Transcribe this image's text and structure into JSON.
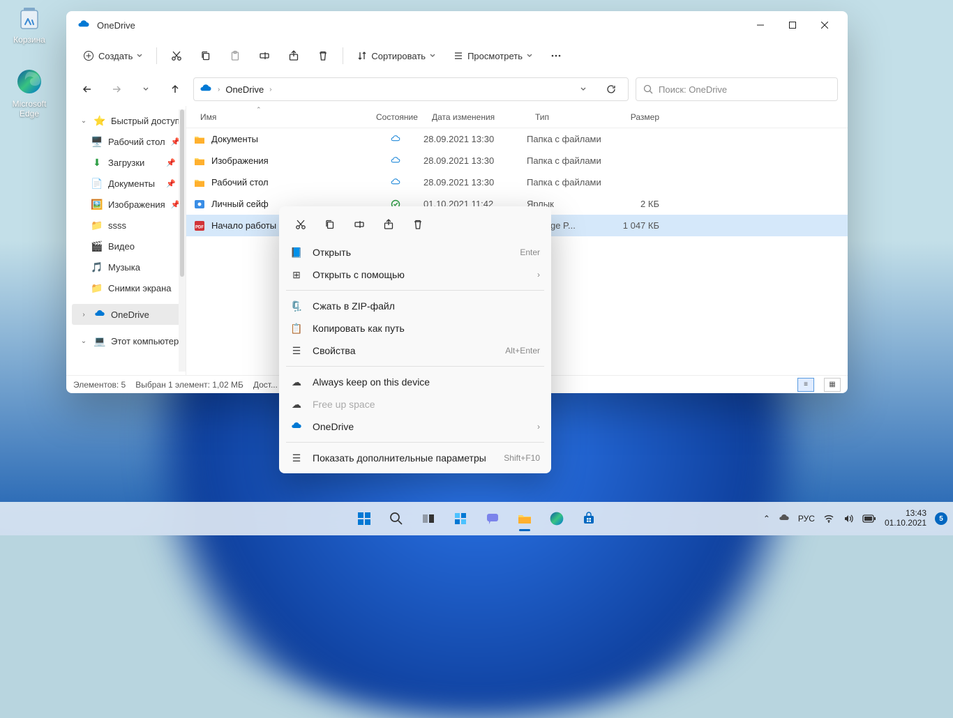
{
  "desktop": {
    "recycle_bin": "Корзина",
    "edge": "Microsoft Edge"
  },
  "window": {
    "title": "OneDrive",
    "toolbar": {
      "create": "Создать",
      "sort": "Сортировать",
      "view": "Просмотреть"
    },
    "nav": {
      "breadcrumb_root": "OneDrive"
    },
    "search_placeholder": "Поиск: OneDrive",
    "columns": {
      "name": "Имя",
      "state": "Состояние",
      "date": "Дата изменения",
      "type": "Тип",
      "size": "Размер"
    },
    "sidebar": {
      "quick": "Быстрый доступ",
      "desktop": "Рабочий стол",
      "downloads": "Загрузки",
      "documents": "Документы",
      "pictures": "Изображения",
      "ssss": "ssss",
      "video": "Видео",
      "music": "Музыка",
      "screenshots": "Снимки экрана",
      "onedrive": "OneDrive",
      "thispc": "Этот компьютер"
    },
    "rows": [
      {
        "name": "Документы",
        "kind": "folder",
        "date": "28.09.2021 13:30",
        "type": "Папка с файлами",
        "size": ""
      },
      {
        "name": "Изображения",
        "kind": "folder",
        "date": "28.09.2021 13:30",
        "type": "Папка с файлами",
        "size": ""
      },
      {
        "name": "Рабочий стол",
        "kind": "folder",
        "date": "28.09.2021 13:30",
        "type": "Папка с файлами",
        "size": ""
      },
      {
        "name": "Личный сейф",
        "kind": "vault",
        "date": "01.10.2021 11:42",
        "type": "Ярлык",
        "size": "2 КБ"
      },
      {
        "name": "Начало работы с OneDrive",
        "kind": "pdf",
        "date": "",
        "type": "oft Edge P...",
        "size": "1 047 КБ"
      }
    ],
    "status": {
      "count": "Элементов: 5",
      "selection": "Выбран 1 элемент: 1,02 МБ",
      "avail": "Дост..."
    }
  },
  "ctx": {
    "open": "Открыть",
    "open_k": "Enter",
    "openwith": "Открыть с помощью",
    "zip": "Сжать в ZIP-файл",
    "copypath": "Копировать как путь",
    "props": "Свойства",
    "props_k": "Alt+Enter",
    "keep": "Always keep on this device",
    "free": "Free up space",
    "onedrive": "OneDrive",
    "more": "Показать дополнительные параметры",
    "more_k": "Shift+F10"
  },
  "tray": {
    "lang": "РУС",
    "time": "13:43",
    "date": "01.10.2021",
    "badge": "5"
  }
}
